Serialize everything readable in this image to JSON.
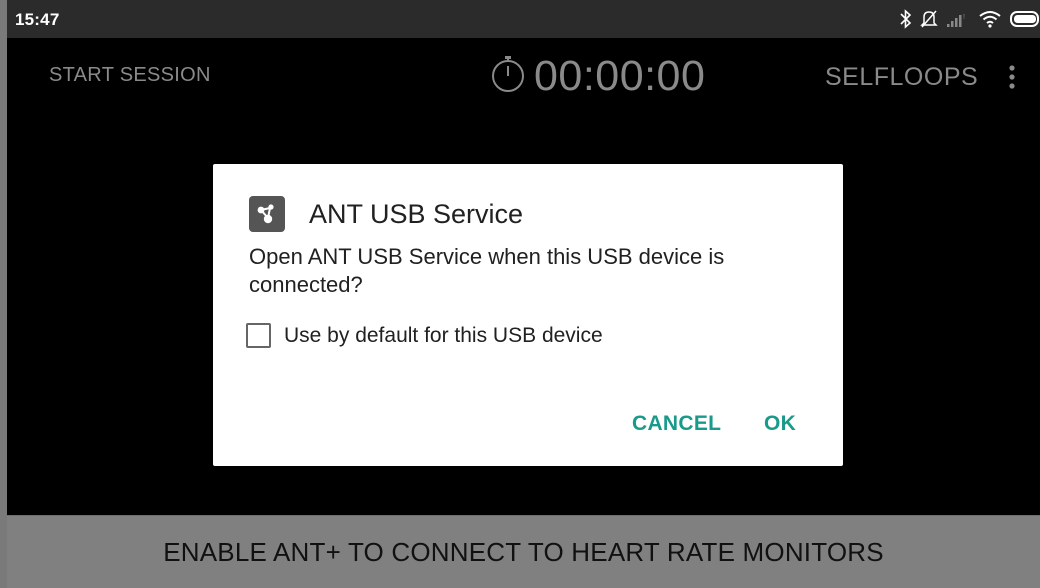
{
  "status_bar": {
    "time": "15:47",
    "icons": [
      "bluetooth-icon",
      "mute-icon",
      "signal-icon",
      "wifi-icon",
      "battery-icon"
    ]
  },
  "toolbar": {
    "start_label": "START SESSION",
    "timer": "00:00:00",
    "selfloops_label": "SELFLOOPS",
    "timer_icon": "stopwatch-icon",
    "menu_icon": "overflow-menu-icon"
  },
  "dialog": {
    "app_icon": "ant-usb-app-icon",
    "title": "ANT USB Service",
    "message": "Open ANT USB Service when this USB device is connected?",
    "checkbox_label": "Use by default for this USB device",
    "checkbox_checked": false,
    "cancel_label": "CANCEL",
    "ok_label": "OK"
  },
  "banner": {
    "text": "ENABLE ANT+ TO CONNECT TO HEART RATE MONITORS"
  },
  "colors": {
    "accent": "#1a9a8a",
    "background": "#000000",
    "toolbar_text": "#8a8a8a",
    "banner_bg": "#808080",
    "status_bar_bg": "#2b2b2b"
  }
}
